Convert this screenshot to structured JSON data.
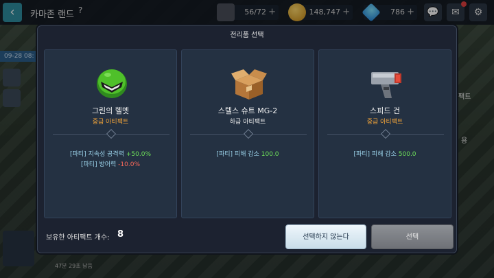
{
  "topbar": {
    "area_name": "카마존 랜드",
    "help": "?",
    "stamina": "56/72",
    "coins": "148,747",
    "gems": "786",
    "plus": "+"
  },
  "side": {
    "date": "09-28 08:",
    "timer": "47분 29초 남음",
    "label_artifact": "팩트",
    "label_use": "용"
  },
  "modal": {
    "title": "전리품 선택",
    "cards": [
      {
        "name": "그린의 헬멧",
        "grade": "중급 아티팩트",
        "stats": [
          {
            "label": "[파티] 지속성 공격력 ",
            "value": "+50.0%"
          },
          {
            "label": "[파티] 방어력 ",
            "value": "-10.0%"
          }
        ]
      },
      {
        "name": "스텔스 슈트 MG-2",
        "grade": "하급 아티팩트",
        "stats": [
          {
            "label": "[파티] 피해 감소 ",
            "value": "100.0"
          }
        ]
      },
      {
        "name": "스피드 건",
        "grade": "중급 아티팩트",
        "stats": [
          {
            "label": "[파티] 피해 감소 ",
            "value": "500.0"
          }
        ]
      }
    ],
    "owned_label": "보유한 아티팩트 개수:",
    "owned_count": "8",
    "btn_no_select": "선택하지 않는다",
    "btn_select": "선택"
  },
  "colors": {
    "grade_mid": "#f0a33a",
    "grade_low": "#e8e8e8",
    "positive": "#6ee05a",
    "negative": "#ff6a5a",
    "stat_label": "#9ad1e8"
  },
  "icons": {
    "card1": "green-helmet-icon",
    "card2": "cardboard-box-icon",
    "card3": "speed-gun-icon"
  }
}
